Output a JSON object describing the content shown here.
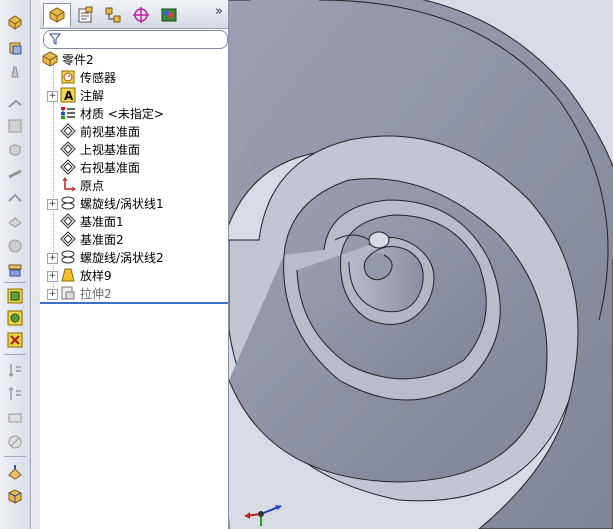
{
  "toolbar": {
    "icons": [
      "extruded-boss-icon",
      "revolved-boss-icon",
      "swept-boss-icon",
      "lofted-boss-icon",
      "extruded-cut-icon",
      "revolved-cut-icon",
      "swept-cut-icon",
      "fillet-icon",
      "chamfer-icon",
      "shell-icon",
      "rib-icon",
      "reference-geometry-icon",
      "curves-icon",
      "instant3d-icon",
      "linear-pattern-icon",
      "mirror-icon",
      "draft-icon",
      "dome-icon",
      "wrap-icon",
      "intersect-icon",
      "section-view-icon",
      "view-orientation-icon"
    ]
  },
  "panel": {
    "tabs": [
      "feature-manager-tab",
      "property-manager-tab",
      "configuration-manager-tab",
      "dimxpert-manager-tab",
      "display-manager-tab"
    ],
    "expand_glyph": "»",
    "tree": {
      "root": "零件2",
      "items": [
        {
          "label": "传感器",
          "icon": "sensor-icon",
          "expandable": false
        },
        {
          "label": "注解",
          "icon": "annotation-icon",
          "expandable": true
        },
        {
          "label": "材质 <未指定>",
          "icon": "material-icon",
          "expandable": false
        },
        {
          "label": "前视基准面",
          "icon": "plane-icon",
          "expandable": false
        },
        {
          "label": "上视基准面",
          "icon": "plane-icon",
          "expandable": false
        },
        {
          "label": "右视基准面",
          "icon": "plane-icon",
          "expandable": false
        },
        {
          "label": "原点",
          "icon": "origin-icon",
          "expandable": false
        },
        {
          "label": "螺旋线/涡状线1",
          "icon": "helix-icon",
          "expandable": true
        },
        {
          "label": "基准面1",
          "icon": "plane-icon",
          "expandable": false
        },
        {
          "label": "基准面2",
          "icon": "plane-icon",
          "expandable": false
        },
        {
          "label": "螺旋线/涡状线2",
          "icon": "helix-icon",
          "expandable": true
        },
        {
          "label": "放样9",
          "icon": "loft-icon",
          "expandable": true
        },
        {
          "label": "拉伸2",
          "icon": "extrude-icon",
          "expandable": true,
          "suppressed": true
        }
      ]
    }
  },
  "colors": {
    "model": "#8f93a6",
    "model_dark": "#5f6377",
    "model_light": "#b9bccb",
    "background": "#d8dae4",
    "rollback_bar": "#3a6ec8"
  }
}
